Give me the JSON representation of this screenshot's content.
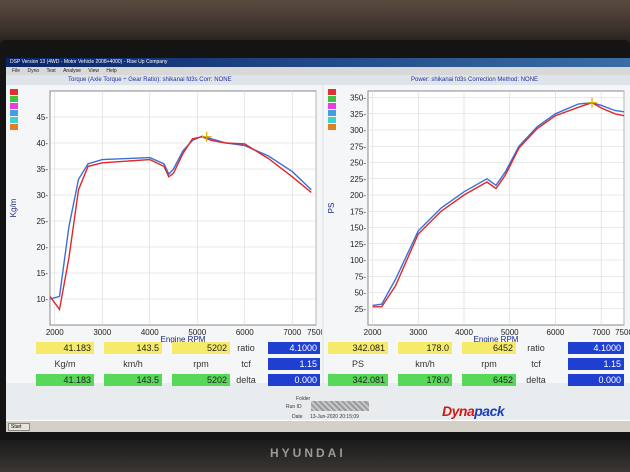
{
  "window": {
    "title": "DSP Version 13 (4WD - Motor Vehicle 2008+4000) - Rise Up Company",
    "menu": [
      "File",
      "Dyno",
      "Test",
      "Analyse",
      "View",
      "Help"
    ]
  },
  "graphs": {
    "left_title": "Torque (Axle Torque ÷ Gear Ratio): shikanai fd3s     Corr: NONE",
    "right_title": "Power: shikanai fd3s     Correction Method: NONE"
  },
  "legend_colors": [
    "#e03030",
    "#40c040",
    "#e040e0",
    "#40a0e0",
    "#40d0d0",
    "#e08020"
  ],
  "chart_data": [
    {
      "type": "line",
      "xlabel": "Engine RPM",
      "ylabel": "Kg/m",
      "xlim": [
        1900,
        7500
      ],
      "ylim": [
        5,
        50
      ],
      "xticks": [
        2000,
        3000,
        4000,
        5000,
        6000,
        7000,
        7500
      ],
      "yticks": [
        10,
        15,
        20,
        25,
        30,
        35,
        40,
        45
      ],
      "ytick_labels": [
        "10-",
        "15-",
        "20-",
        "25-",
        "30-",
        "35-",
        "40-",
        "45-"
      ],
      "series": [
        {
          "color": "#3b6fd8",
          "x": [
            1900,
            2100,
            2300,
            2500,
            2700,
            3000,
            3500,
            4000,
            4300,
            4400,
            4500,
            4700,
            4900,
            5100,
            5300,
            5600,
            6000,
            6500,
            7000,
            7400
          ],
          "y": [
            10,
            10.5,
            24,
            33,
            36,
            36.8,
            37,
            37.2,
            36,
            34,
            35,
            38.5,
            40.5,
            41.3,
            40.8,
            40,
            39.5,
            37.5,
            34.5,
            31
          ]
        },
        {
          "color": "#e02828",
          "x": [
            1900,
            2100,
            2300,
            2500,
            2700,
            3000,
            3500,
            4000,
            4300,
            4400,
            4500,
            4700,
            4900,
            5100,
            5300,
            5600,
            6000,
            6500,
            7000,
            7400
          ],
          "y": [
            10.5,
            8,
            18,
            31,
            35.5,
            36.2,
            36.5,
            36.8,
            35.5,
            33.5,
            34.2,
            38,
            40.8,
            41.2,
            40.5,
            40,
            39.8,
            37,
            33.5,
            30.5
          ]
        }
      ],
      "marker": {
        "x": 5200,
        "y": 41.2
      }
    },
    {
      "type": "line",
      "xlabel": "Engine RPM",
      "ylabel": "PS",
      "xlim": [
        1900,
        7500
      ],
      "ylim": [
        0,
        360
      ],
      "xticks": [
        2000,
        3000,
        4000,
        5000,
        6000,
        7000,
        7500
      ],
      "yticks": [
        25,
        50,
        75,
        100,
        125,
        150,
        175,
        200,
        225,
        250,
        275,
        300,
        325,
        350
      ],
      "ytick_labels": [
        "25-",
        "50-",
        "75-",
        "100-",
        "125-",
        "150-",
        "175-",
        "200-",
        "225-",
        "250-",
        "275-",
        "300-",
        "325-",
        "350-"
      ],
      "series": [
        {
          "color": "#3b6fd8",
          "x": [
            2000,
            2200,
            2500,
            3000,
            3500,
            4000,
            4500,
            4700,
            4900,
            5200,
            5600,
            6000,
            6500,
            6800,
            7000,
            7300,
            7500
          ],
          "y": [
            30,
            32,
            70,
            145,
            180,
            205,
            225,
            215,
            235,
            275,
            305,
            325,
            340,
            342,
            338,
            330,
            328
          ]
        },
        {
          "color": "#e02828",
          "x": [
            2000,
            2200,
            2500,
            3000,
            3500,
            4000,
            4500,
            4700,
            4900,
            5200,
            5600,
            6000,
            6500,
            6800,
            7000,
            7300,
            7500
          ],
          "y": [
            28,
            28,
            60,
            140,
            175,
            200,
            220,
            210,
            230,
            272,
            302,
            322,
            335,
            342,
            334,
            325,
            322
          ]
        }
      ],
      "marker": {
        "x": 6800,
        "y": 342
      }
    }
  ],
  "readouts": {
    "left": {
      "top": [
        "41.183",
        "143.5",
        "5202"
      ],
      "labels": [
        "Kg/m",
        "km/h",
        "rpm"
      ],
      "bottom": [
        "41.183",
        "143.5",
        "5202"
      ],
      "param_labels": [
        "ratio",
        "tcf",
        "delta"
      ],
      "param_values": [
        "4.1000",
        "1.15",
        "0.000"
      ]
    },
    "right": {
      "top": [
        "342.081",
        "178.0",
        "6452"
      ],
      "labels": [
        "PS",
        "km/h",
        "rpm"
      ],
      "bottom": [
        "342.081",
        "178.0",
        "6452"
      ],
      "param_labels": [
        "ratio",
        "tcf",
        "delta"
      ],
      "param_values": [
        "4.1000",
        "1.15",
        "0.000"
      ]
    }
  },
  "info": {
    "folder_label": "Folder",
    "run_label": "Run ID",
    "date_label": "Date",
    "date_value": "13-Jun-2020 20:15:09"
  },
  "logo": {
    "dyna": "Dyna",
    "pack": "pack"
  },
  "taskbar": {
    "start": "Start"
  },
  "monitor_brand": "HYUNDAI"
}
